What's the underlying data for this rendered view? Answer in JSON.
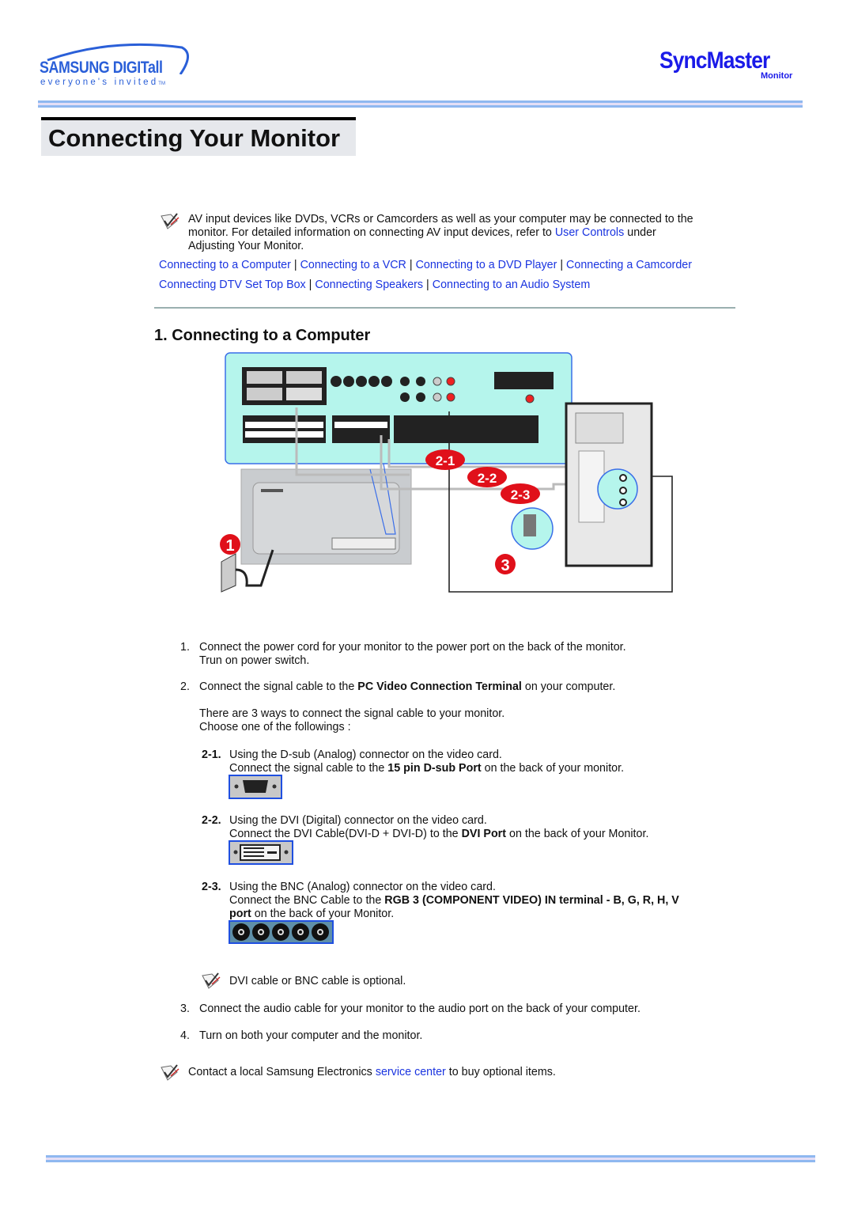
{
  "header": {
    "logo_left": {
      "brand": "SAMSUNG DIGITall",
      "tagline": "everyone's invited",
      "tm": "TM"
    },
    "logo_right": {
      "brand": "SyncMaster",
      "sub": "Monitor"
    },
    "title": "Connecting Your Monitor"
  },
  "intro": {
    "line1": "AV input devices like DVDs, VCRs or Camcorders as well as your computer may be connected to the",
    "line2_pre": "monitor. For detailed information on connecting AV input devices, refer to ",
    "line2_link": "User Controls",
    "line2_post": " under",
    "line3": "Adjusting Your Monitor."
  },
  "nav_links": [
    "Connecting to a Computer",
    "Connecting to a VCR",
    "Connecting to a DVD Player",
    "Connecting a Camcorder",
    "Connecting DTV Set Top Box",
    "Connecting Speakers",
    "Connecting to an Audio System"
  ],
  "separator": " | ",
  "section": {
    "heading": "1. Connecting to a Computer"
  },
  "diagram": {
    "callouts": [
      "1",
      "2-1",
      "2-2",
      "2-3",
      "3"
    ],
    "callout_color": "#e0101a",
    "panel_color": "#b5f5ec"
  },
  "steps": {
    "s1": {
      "num": "1.",
      "line1": "Connect the power cord for your monitor to the power port on the back of the monitor.",
      "line2": "Trun on power switch."
    },
    "s2": {
      "num": "2.",
      "pre": "Connect the signal cable to the ",
      "bold": "PC Video Connection Terminal",
      "post": " on your computer.",
      "para1": "There are 3 ways to connect the signal cable to your monitor.",
      "para2": "Choose one of the followings :"
    },
    "s21": {
      "num": "2-1.",
      "line1": "Using the D-sub (Analog) connector on the video card.",
      "pre": "Connect the signal cable to the ",
      "bold": "15 pin D-sub Port",
      "post": " on the back of your monitor."
    },
    "s22": {
      "num": "2-2.",
      "line1": "Using the DVI (Digital) connector on the video card.",
      "pre": "Connect the DVI Cable(DVI-D + DVI-D) to the ",
      "bold": "DVI Port",
      "post": " on the back of your Monitor."
    },
    "s23": {
      "num": "2-3.",
      "line1": "Using the BNC (Analog) connector on the video card.",
      "pre": "Connect the BNC Cable to the ",
      "bold": "RGB 3 (COMPONENT VIDEO) IN terminal - B, G, R, H, V",
      "bold2": "port",
      "post": " on the back of your Monitor."
    },
    "note": "DVI cable or BNC cable is optional.",
    "s3": {
      "num": "3.",
      "text": "Connect the audio cable for your monitor to the audio port on the back of your computer."
    },
    "s4": {
      "num": "4.",
      "text": "Turn on both your computer and the monitor."
    }
  },
  "footer_note": {
    "pre": "Contact a local Samsung Electronics ",
    "link": "service center",
    "post": " to buy optional items."
  },
  "colors": {
    "link": "#1a34e0",
    "rule": "#8fb8f0",
    "title_bg": "#e6e8ec"
  }
}
